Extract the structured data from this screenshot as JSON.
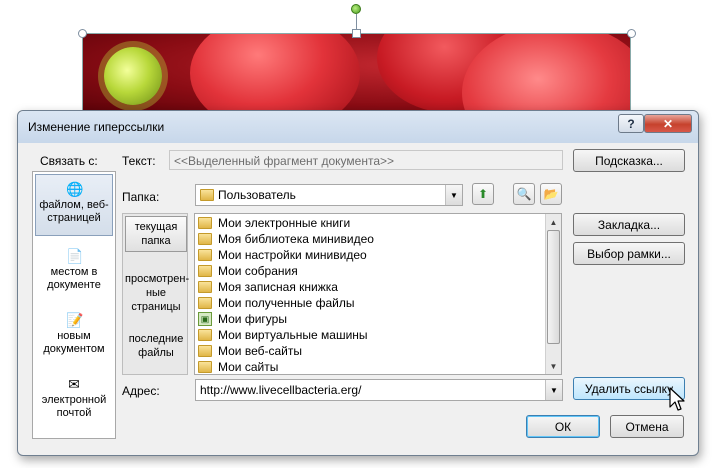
{
  "dialog": {
    "title": "Изменение гиперссылки",
    "help_label": "?",
    "close_label": "✕"
  },
  "link_to": {
    "label": "Связать с:",
    "items": [
      {
        "label": "файлом, веб-страницей",
        "icon": "globe-file-icon",
        "selected": true
      },
      {
        "label": "местом в документе",
        "icon": "document-place-icon",
        "selected": false
      },
      {
        "label": "новым документом",
        "icon": "new-document-icon",
        "selected": false
      },
      {
        "label": "электронной почтой",
        "icon": "email-icon",
        "selected": false
      }
    ]
  },
  "text_row": {
    "label": "Текст:",
    "value": "<<Выделенный фрагмент документа>>"
  },
  "folder_row": {
    "label": "Папка:",
    "value": "Пользователь"
  },
  "nav": {
    "items": [
      {
        "label": "текущая папка",
        "selected": true
      },
      {
        "label": "просмотрен-ные страницы",
        "selected": false
      },
      {
        "label": "последние файлы",
        "selected": false
      }
    ]
  },
  "files": [
    {
      "name": "Мои электронные книги",
      "icon": "folder-icon"
    },
    {
      "name": "Моя библиотека минивидео",
      "icon": "folder-icon"
    },
    {
      "name": "Мои настройки минивидео",
      "icon": "folder-icon"
    },
    {
      "name": "Мои собрания",
      "icon": "folder-icon"
    },
    {
      "name": "Моя записная книжка",
      "icon": "folder-icon"
    },
    {
      "name": "Мои полученные файлы",
      "icon": "folder-icon"
    },
    {
      "name": "Мои фигуры",
      "icon": "shapes-folder-icon"
    },
    {
      "name": "Мои виртуальные машины",
      "icon": "folder-icon"
    },
    {
      "name": "Мои веб-сайты",
      "icon": "folder-icon"
    },
    {
      "name": "Мои сайты",
      "icon": "folder-icon"
    }
  ],
  "address_row": {
    "label": "Адрес:",
    "value": "http://www.livecellbacteria.erg/"
  },
  "buttons": {
    "tooltip": "Подсказка...",
    "bookmark": "Закладка...",
    "frame": "Выбор рамки...",
    "remove_link": "Удалить ссылку",
    "ok": "ОК",
    "cancel": "Отмена"
  },
  "colors": {
    "titlebar": "#c7d7ea",
    "close_button": "#c6422d",
    "hover_button": "#bee6fd"
  }
}
